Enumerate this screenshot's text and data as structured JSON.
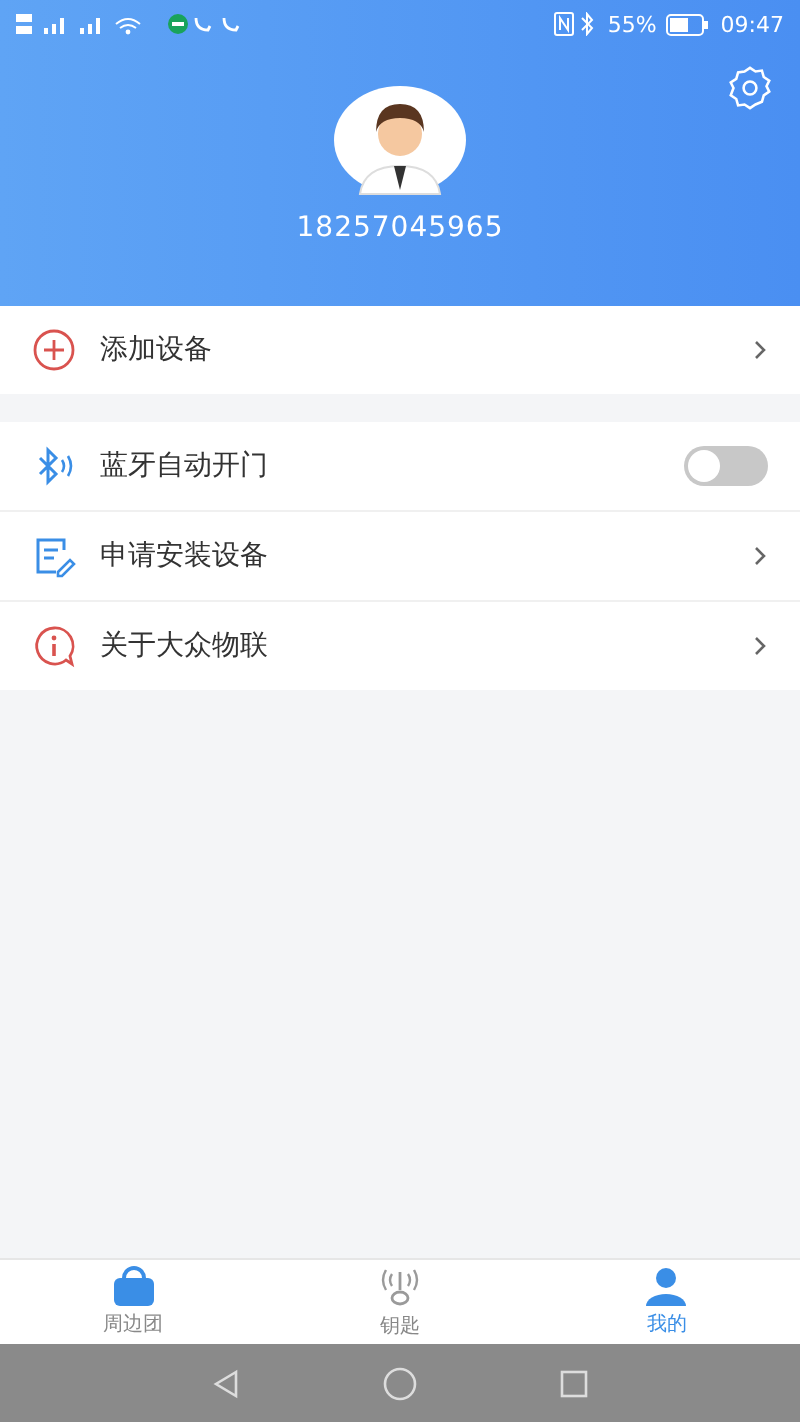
{
  "status_bar": {
    "battery": "55%",
    "time": "09:47"
  },
  "profile": {
    "phone": "18257045965"
  },
  "menu_groups": [
    {
      "items": [
        {
          "kind": "link",
          "label": "添加设备"
        }
      ]
    },
    {
      "items": [
        {
          "kind": "toggle",
          "label": "蓝牙自动开门",
          "on": false
        },
        {
          "kind": "link",
          "label": "申请安装设备"
        },
        {
          "kind": "link",
          "label": "关于大众物联"
        }
      ]
    }
  ],
  "tabs": [
    {
      "label": "周边团",
      "selected": false
    },
    {
      "label": "钥匙",
      "selected": false
    },
    {
      "label": "我的",
      "selected": true
    }
  ]
}
